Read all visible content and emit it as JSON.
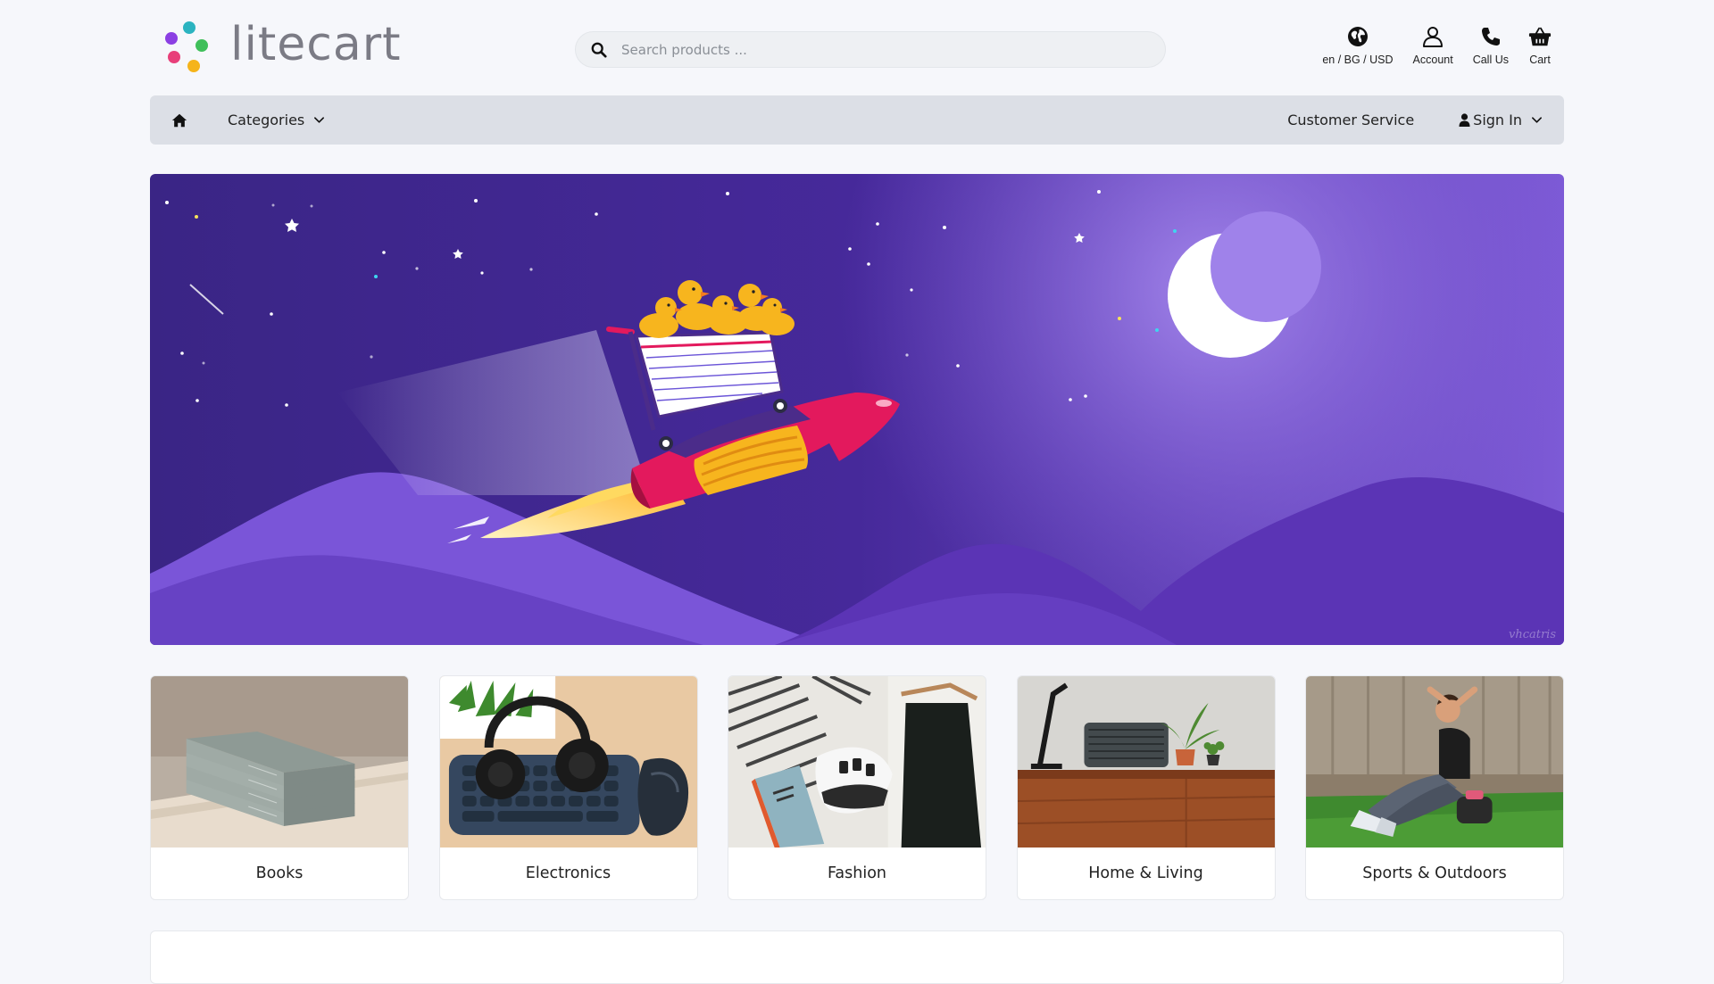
{
  "brand": {
    "name": "litecart"
  },
  "search": {
    "placeholder": "Search products ..."
  },
  "header_icons": {
    "region": {
      "label": "en / BG / USD",
      "icon": "globe-icon"
    },
    "account": {
      "label": "Account",
      "icon": "user-icon"
    },
    "call": {
      "label": "Call Us",
      "icon": "phone-icon"
    },
    "cart": {
      "label": "Cart",
      "icon": "basket-icon"
    }
  },
  "nav": {
    "home_icon": "home-icon",
    "categories_label": "Categories",
    "customer_service_label": "Customer Service",
    "sign_in_label": "Sign In"
  },
  "banner": {
    "credit": "vhcatris"
  },
  "categories": [
    {
      "label": "Books"
    },
    {
      "label": "Electronics"
    },
    {
      "label": "Fashion"
    },
    {
      "label": "Home & Living"
    },
    {
      "label": "Sports & Outdoors"
    }
  ],
  "colors": {
    "accent_purple": "#5b36c4",
    "nav_bg": "#dcdfe6",
    "page_bg": "#f6f7fb"
  }
}
